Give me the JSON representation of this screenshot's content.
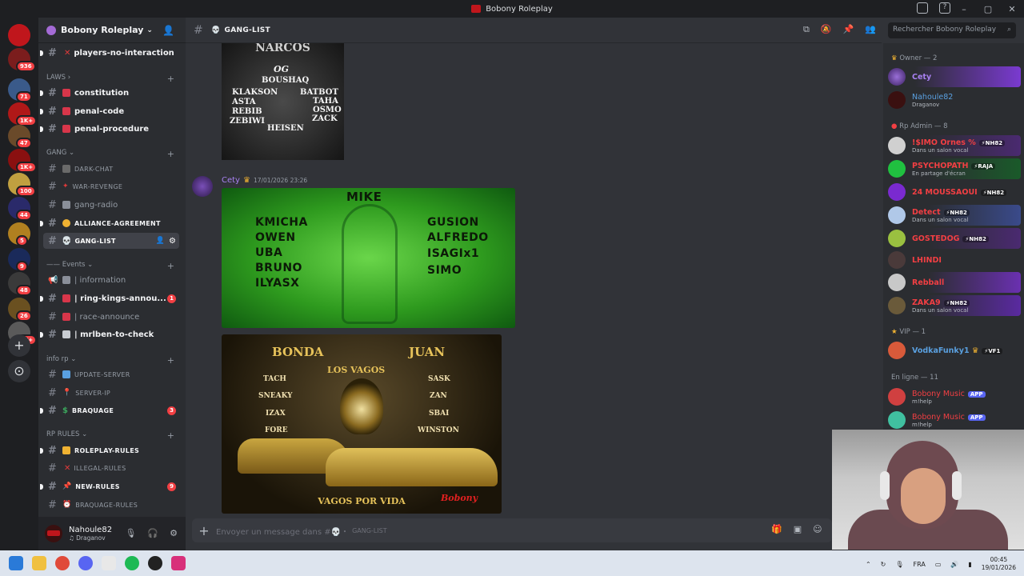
{
  "window": {
    "title": "Bobony Roleplay"
  },
  "rail": {
    "servers": [
      {
        "badge": "936",
        "color": "#7b1d1d"
      },
      {
        "badge": "71",
        "color": "#3a5a8a"
      },
      {
        "badge": "1K+",
        "color": "#b01818"
      },
      {
        "badge": "47",
        "color": "#6a4a2a"
      },
      {
        "badge": "1K+",
        "color": "#8a1010"
      },
      {
        "badge": "100",
        "color": "#c0a040"
      },
      {
        "badge": "44",
        "color": "#2a2a6a"
      },
      {
        "badge": "5",
        "color": "#b08020"
      },
      {
        "badge": "9",
        "color": "#1a2a5a"
      },
      {
        "badge": "48",
        "color": "#3a3a3a"
      },
      {
        "badge": "26",
        "color": "#6a5020"
      },
      {
        "badge": "2K+",
        "color": "#5a5a5a"
      }
    ]
  },
  "guild": {
    "name": "Bobony Roleplay"
  },
  "sidebar": {
    "channels_top": [
      {
        "label": "players-no-interaction",
        "emoji": "✕"
      }
    ],
    "categories": {
      "laws": "LAWS",
      "gang": "GANG",
      "events": "Events",
      "inforp": "info rp",
      "rprules": "RP RULES"
    },
    "laws": [
      {
        "label": "constitution"
      },
      {
        "label": "penal-code"
      },
      {
        "label": "penal-procedure"
      }
    ],
    "gang": [
      {
        "label": "DARK-CHAT"
      },
      {
        "label": "WAR-REVENGE"
      },
      {
        "label": "gang-radio"
      },
      {
        "label": "ALLIANCE-AGREEMENT"
      },
      {
        "label": "GANG-LIST"
      }
    ],
    "events": [
      {
        "label": "| information"
      },
      {
        "label": "| ring-kings-annou...",
        "badge": "1"
      },
      {
        "label": "| race-announce"
      },
      {
        "label": "| mrlben-to-check"
      }
    ],
    "inforp": [
      {
        "label": "UPDATE-SERVER"
      },
      {
        "label": "SERVER-IP"
      },
      {
        "label": "BRAQUAGE",
        "badge": "3"
      }
    ],
    "rprules": [
      {
        "label": "ROLEPLAY-RULES"
      },
      {
        "label": "ILLEGAL-RULES"
      },
      {
        "label": "NEW-RULES",
        "badge": "9"
      },
      {
        "label": "BRAQUAGE-RULES"
      }
    ]
  },
  "user": {
    "name": "Nahoule82",
    "status": "Draganov"
  },
  "header": {
    "channel": "GANG-LIST",
    "search_placeholder": "Rechercher Bobony Roleplay"
  },
  "messages": {
    "img1": {
      "title": "NARCOS",
      "og": "OG",
      "leader": "BOUSHAQ",
      "left": [
        "KLAKSON",
        "ASTA",
        "REBIB",
        "ZEBIWI"
      ],
      "right": [
        "BATBOT",
        "TAHA",
        "OSMO",
        "ZACK"
      ],
      "bottom": "HEISEN"
    },
    "author": "Cety",
    "timestamp": "17/01/2026 23:26",
    "img2": {
      "top": "MIKE",
      "left": [
        "KMICHA",
        "OWEN",
        "UBA",
        "BRUNO",
        "ILYASX"
      ],
      "right": [
        "GUSION",
        "ALFREDO",
        "ISAGIx1",
        "SIMO"
      ]
    },
    "img3": {
      "left_boss": "BONDA",
      "right_boss": "JUAN",
      "gang": "LOS VAGOS",
      "left": [
        "TACH",
        "SNEAKY",
        "IZAX",
        "FORE"
      ],
      "right": [
        "SASK",
        "ZAN",
        "SBAI",
        "WINSTON"
      ],
      "motto": "VAGOS POR VIDA",
      "signature": "Bobony"
    }
  },
  "composer": {
    "placeholder": "Envoyer un message dans #💀・",
    "channel": "GANG-LIST"
  },
  "members": {
    "owner_cat": "Owner — 2",
    "owners": [
      {
        "name": "Cety",
        "color": "#a780f0"
      },
      {
        "name": "Nahoule82",
        "sub": "Draganov",
        "color": "#5aa0e0"
      }
    ],
    "admin_cat": "Rp Admin — 8",
    "admins": [
      {
        "name": "!$IMO Ornes %",
        "tag": "⚡NH82",
        "sub": "Dans un salon vocal",
        "color": "#f23f43"
      },
      {
        "name": "PSYCHOPATH",
        "tag": "⚡RAJA",
        "sub": "En partage d'écran",
        "color": "#f23f43"
      },
      {
        "name": "24 MOUSSAOUI",
        "tag": "⚡NH82",
        "color": "#f23f43"
      },
      {
        "name": "Detect",
        "tag": "⚡NH82",
        "sub": "Dans un salon vocal",
        "color": "#f23f43"
      },
      {
        "name": "GOSTEDOG",
        "tag": "⚡NH82",
        "color": "#f23f43"
      },
      {
        "name": "LHINDI",
        "color": "#f23f43"
      },
      {
        "name": "Rebball",
        "color": "#f23f43"
      },
      {
        "name": "ZAKA9",
        "tag": "⚡NH82",
        "sub": "Dans un salon vocal",
        "color": "#f23f43"
      }
    ],
    "vip_cat": "VIP — 1",
    "vips": [
      {
        "name": "VodkaFunky1",
        "tag": "⚡VF1",
        "color": "#5aa0e0"
      }
    ],
    "online_cat": "En ligne — 11",
    "online": [
      {
        "name": "Bobony Music",
        "app": "APP",
        "sub": "m!help",
        "color": "#f23f43"
      },
      {
        "name": "Bobony Music",
        "app": "APP",
        "sub": "m!help",
        "color": "#f23f43"
      }
    ]
  },
  "taskbar": {
    "lang": "FRA",
    "time": "00:45",
    "date": "19/01/2026"
  }
}
